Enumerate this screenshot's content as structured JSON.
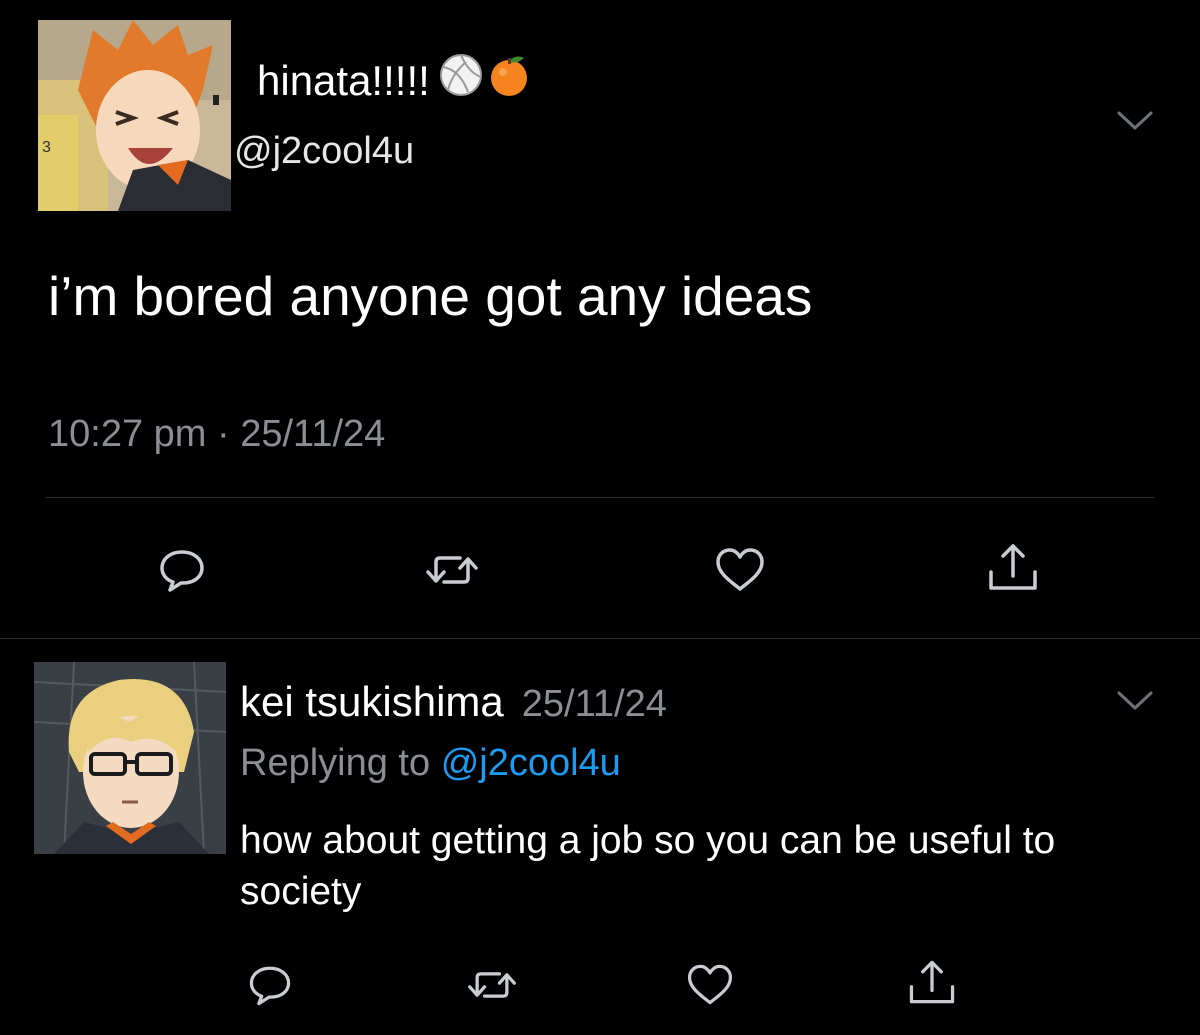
{
  "main_tweet": {
    "display_name": "hinata!!!!!",
    "name_emojis": [
      "volleyball-icon",
      "tangerine-icon"
    ],
    "handle": "@j2cool4u",
    "text": "i’m bored anyone got any ideas",
    "timestamp": "10:27 pm · 25/11/24",
    "avatar": "avatar-hinata"
  },
  "reply_tweet": {
    "display_name": "kei tsukishima",
    "date": "25/11/24",
    "replying_label": "Replying to",
    "replying_handle": "@j2cool4u",
    "text": "how about getting a job so you can be useful to society",
    "avatar": "avatar-tsukishima"
  },
  "actions": [
    "reply-icon",
    "retweet-icon",
    "like-icon",
    "share-icon"
  ],
  "colors": {
    "background": "#000000",
    "text": "#ffffff",
    "muted": "#8b8f94",
    "mention": "#1d9bf0",
    "divider": "#2f3336",
    "icon": "#c9ccd0"
  }
}
